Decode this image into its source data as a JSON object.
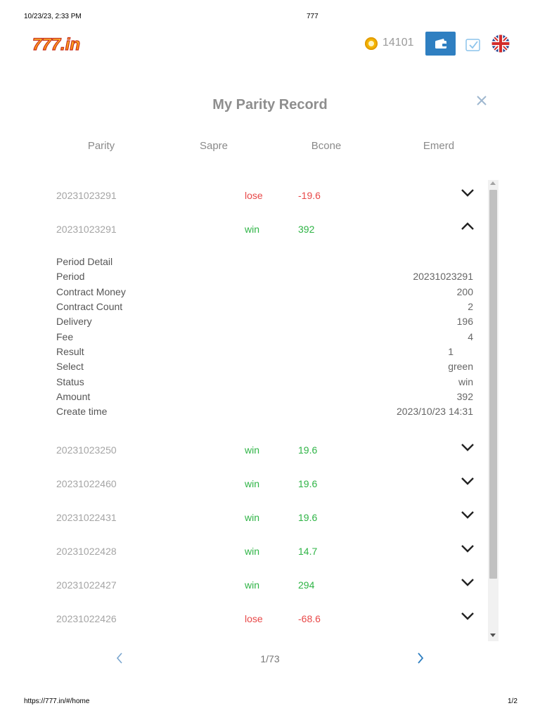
{
  "print": {
    "datetime": "10/23/23, 2:33 PM",
    "page_title": "777",
    "url": "https://777.in/#/home",
    "page_num": "1/2"
  },
  "header": {
    "logo_text": "777.in",
    "balance": "14101",
    "icons": [
      "coin-icon",
      "wallet-icon",
      "check-icon",
      "uk-flag-icon"
    ]
  },
  "dialog": {
    "title": "My Parity Record",
    "columns": [
      "Parity",
      "Sapre",
      "Bcone",
      "Emerd"
    ]
  },
  "records": [
    {
      "period": "20231023291",
      "result": "lose",
      "amount": "-19.6",
      "expanded": false
    },
    {
      "period": "20231023291",
      "result": "win",
      "amount": "392",
      "expanded": true
    },
    {
      "period": "20231023250",
      "result": "win",
      "amount": "19.6",
      "expanded": false
    },
    {
      "period": "20231022460",
      "result": "win",
      "amount": "19.6",
      "expanded": false
    },
    {
      "period": "20231022431",
      "result": "win",
      "amount": "19.6",
      "expanded": false
    },
    {
      "period": "20231022428",
      "result": "win",
      "amount": "14.7",
      "expanded": false
    },
    {
      "period": "20231022427",
      "result": "win",
      "amount": "294",
      "expanded": false
    },
    {
      "period": "20231022426",
      "result": "lose",
      "amount": "-68.6",
      "expanded": false
    }
  ],
  "detail": {
    "title": "Period Detail",
    "rows": [
      {
        "label": "Period",
        "value": "20231023291"
      },
      {
        "label": "Contract Money",
        "value": "200"
      },
      {
        "label": "Contract Count",
        "value": "2"
      },
      {
        "label": "Delivery",
        "value": "196"
      },
      {
        "label": "Fee",
        "value": "4"
      },
      {
        "label": "Result",
        "value": "1"
      },
      {
        "label": "Select",
        "value": "green"
      },
      {
        "label": "Status",
        "value": "win"
      },
      {
        "label": "Amount",
        "value": "392"
      },
      {
        "label": "Create time",
        "value": "2023/10/23 14:31"
      }
    ]
  },
  "pagination": {
    "current": "1/73"
  },
  "colors": {
    "win": "#2fb446",
    "lose": "#e84848",
    "accent": "#2f7fc1",
    "detail_title": "#2fb446"
  }
}
